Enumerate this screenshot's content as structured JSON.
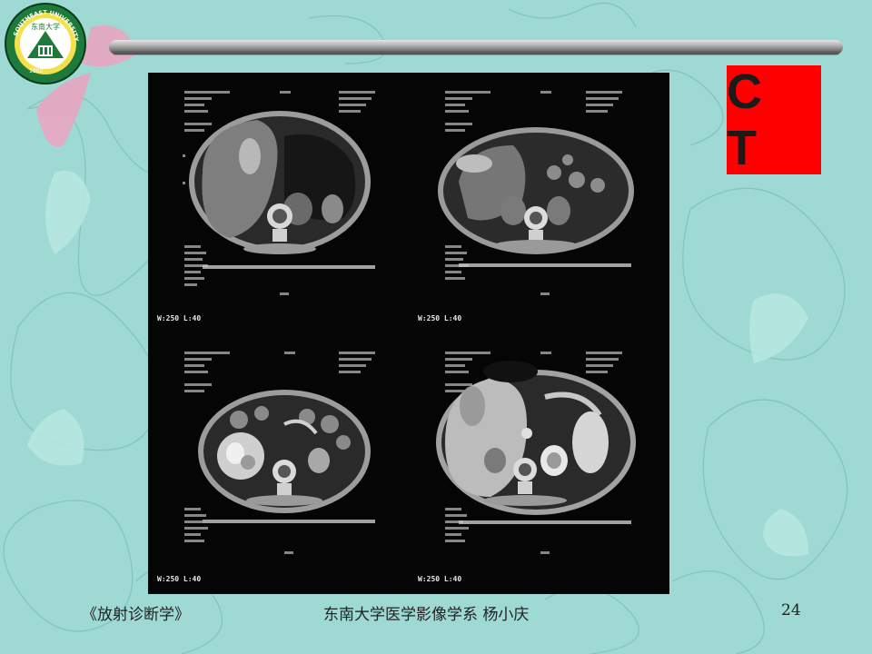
{
  "slide": {
    "title_box_label": "C T",
    "footer_left": "《放射诊断学》",
    "footer_center": "东南大学医学影像学系  杨小庆",
    "page_number": "24"
  },
  "logo": {
    "text": "SOUTHEAST UNIVERSITY",
    "inner_text": "东南大学",
    "year": "1902"
  },
  "scans": [
    {
      "window_level": "W:250 L:40"
    },
    {
      "window_level": "W:250 L:40"
    },
    {
      "window_level": "W:250 L:40"
    },
    {
      "window_level": "W:250 L:40"
    }
  ],
  "colors": {
    "background": "#9fd9d3",
    "ct_box": "#ff0000",
    "panel": "#050505"
  }
}
